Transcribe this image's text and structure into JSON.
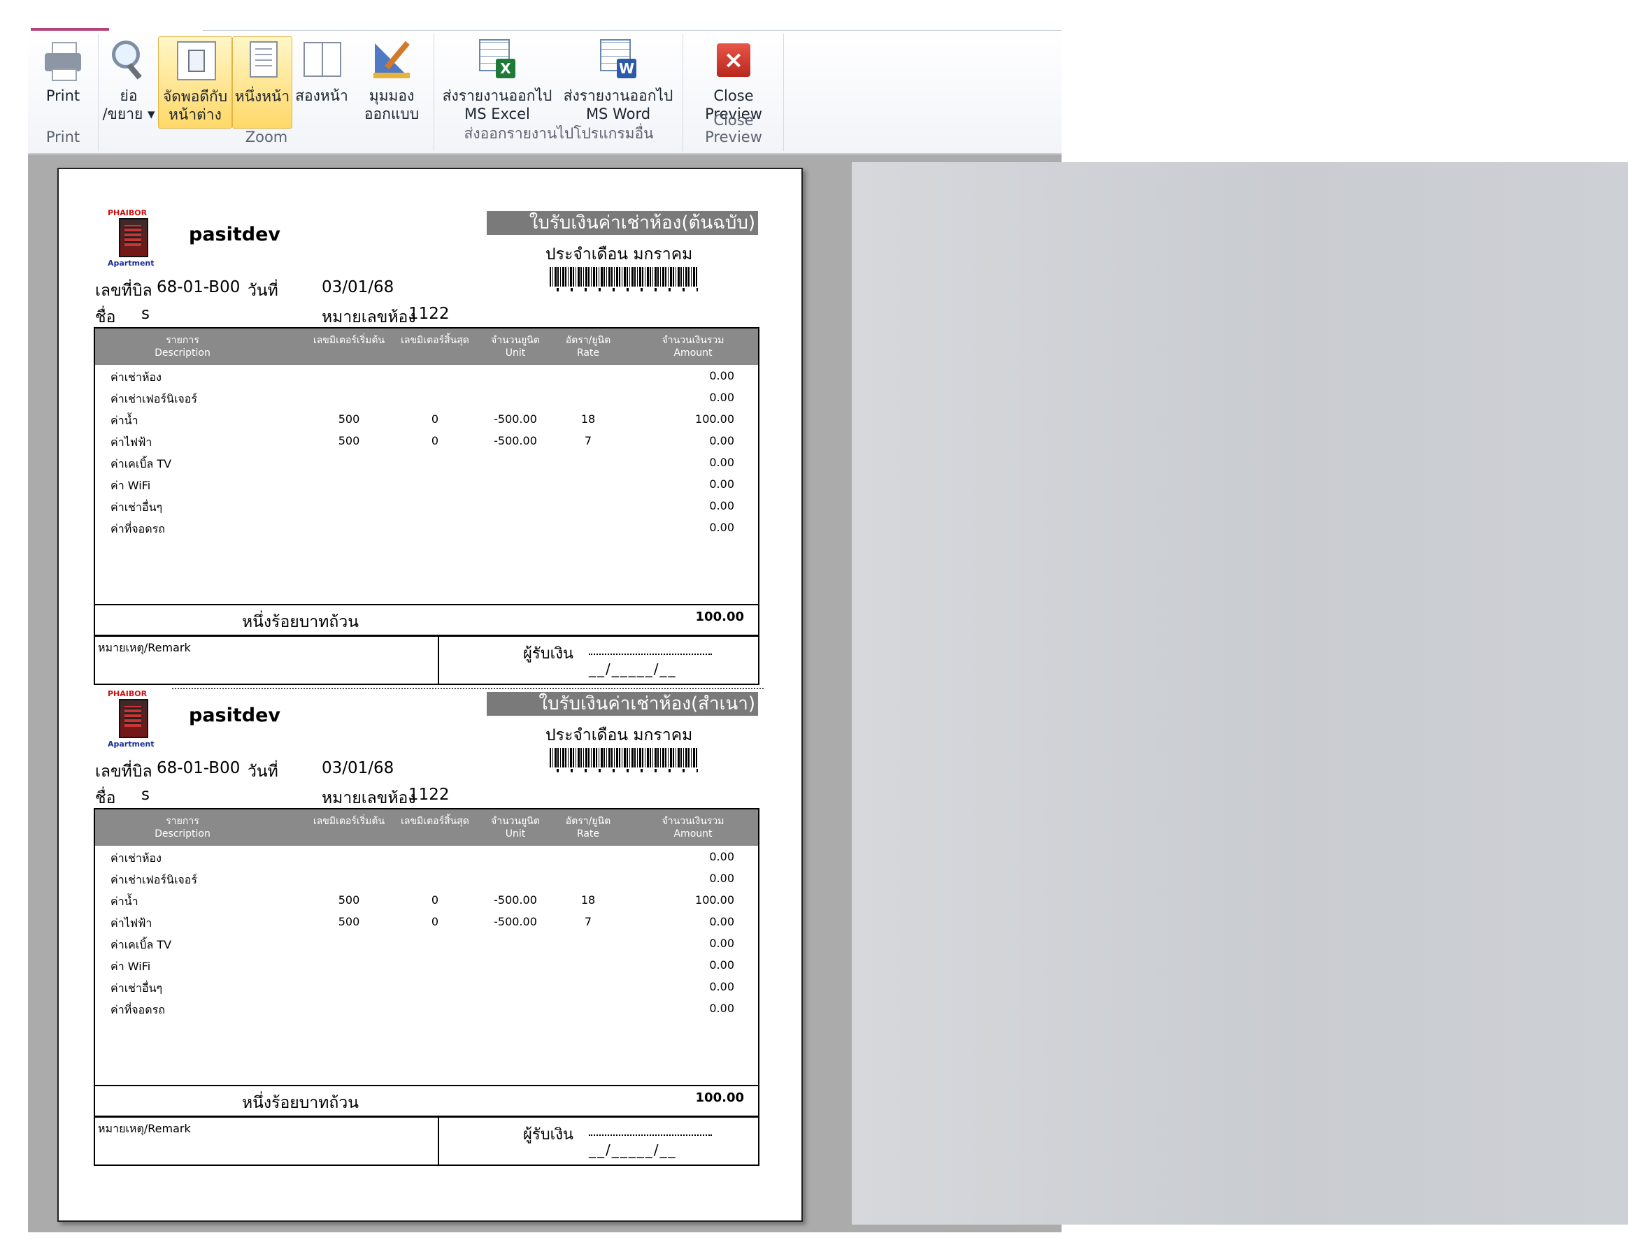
{
  "ribbon": {
    "groups": [
      {
        "caption": "Print"
      },
      {
        "caption": "Zoom"
      },
      {
        "caption": "ส่งออกรายงานไปโปรแกรมอื่น"
      },
      {
        "caption": "Close Preview"
      }
    ],
    "buttons": {
      "print": "Print",
      "zoom": "ย่อ\n/ขยาย ▾",
      "fit_window": "จัดพอดีกับ\nหน้าต่าง",
      "one_page": "หนึ่งหน้า",
      "two_pages": "สองหน้า",
      "design_view": "มุมมอง\nออกแบบ",
      "export_excel": "ส่งรายงานออกไป\nMS Excel",
      "export_word": "ส่งรายงานออกไป\nMS Word",
      "close_preview": "Close\nPreview"
    },
    "icons": {
      "print": "printer-icon",
      "zoom": "magnifier-icon",
      "fit_window": "fit-window-icon",
      "one_page": "one-page-icon",
      "two_pages": "two-pages-icon",
      "design_view": "design-view-icon",
      "export_excel": "excel-export-icon",
      "export_word": "word-export-icon",
      "close_preview": "close-icon"
    },
    "colors": {
      "active_bg": "#ffd867",
      "close_red": "#d0392e",
      "excel_green": "#1f7a3a",
      "word_blue": "#2b5aa8"
    }
  },
  "receipt_common": {
    "brand": "PHAIBOR",
    "apartment": "Apartment",
    "company": "pasitdev",
    "month_label": "ประจำเดือน มกราคม",
    "receipt_no_label": "เลขที่บิล",
    "receipt_no": "68-01-B00",
    "date_label": "วันที่",
    "date": "03/01/68",
    "name_label": "ชื่อ",
    "name": "s",
    "remark_label": "หมายเหตุ/Remark",
    "room_label": "หมายเลขห้อง",
    "room": "1122",
    "headers": [
      "รายการ\nDescription",
      "เลขมิเตอร์เริ่มต้น",
      "เลขมิเตอร์สิ้นสุด",
      "จำนวนยูนิต\nUnit",
      "อัตรา/ยูนิต\nRate",
      "จำนวนเงินรวม\nAmount"
    ],
    "rows": [
      {
        "desc": "ค่าเช่าห้อง",
        "start": "",
        "end": "",
        "unit": "",
        "rate": "",
        "amount": "0.00"
      },
      {
        "desc": "ค่าเช่าเฟอร์นิเจอร์",
        "start": "",
        "end": "",
        "unit": "",
        "rate": "",
        "amount": "0.00"
      },
      {
        "desc": "ค่าน้ำ",
        "start": "500",
        "end": "0",
        "unit": "-500.00",
        "rate": "18",
        "amount": "100.00"
      },
      {
        "desc": "ค่าไฟฟ้า",
        "start": "500",
        "end": "0",
        "unit": "-500.00",
        "rate": "7",
        "amount": "0.00"
      },
      {
        "desc": "ค่าเคเบิ้ล TV",
        "start": "",
        "end": "",
        "unit": "",
        "rate": "",
        "amount": "0.00"
      },
      {
        "desc": "ค่า WiFi",
        "start": "",
        "end": "",
        "unit": "",
        "rate": "",
        "amount": "0.00"
      },
      {
        "desc": "ค่าเช่าอื่นๆ",
        "start": "",
        "end": "",
        "unit": "",
        "rate": "",
        "amount": "0.00"
      },
      {
        "desc": "ค่าที่จอดรถ",
        "start": "",
        "end": "",
        "unit": "",
        "rate": "",
        "amount": "0.00"
      }
    ],
    "total_words": "หนึ่งร้อยบาทถ้วน",
    "total_amount": "100.00",
    "payee_label": "ผู้รับเงิน",
    "date_signature": "__/_____/__"
  },
  "receipts": [
    {
      "title": "ใบรับเงินค่าเช่าห้อง(ต้นฉบับ)"
    },
    {
      "title": "ใบรับเงินค่าเช่าห้อง(สำเนา)"
    }
  ]
}
